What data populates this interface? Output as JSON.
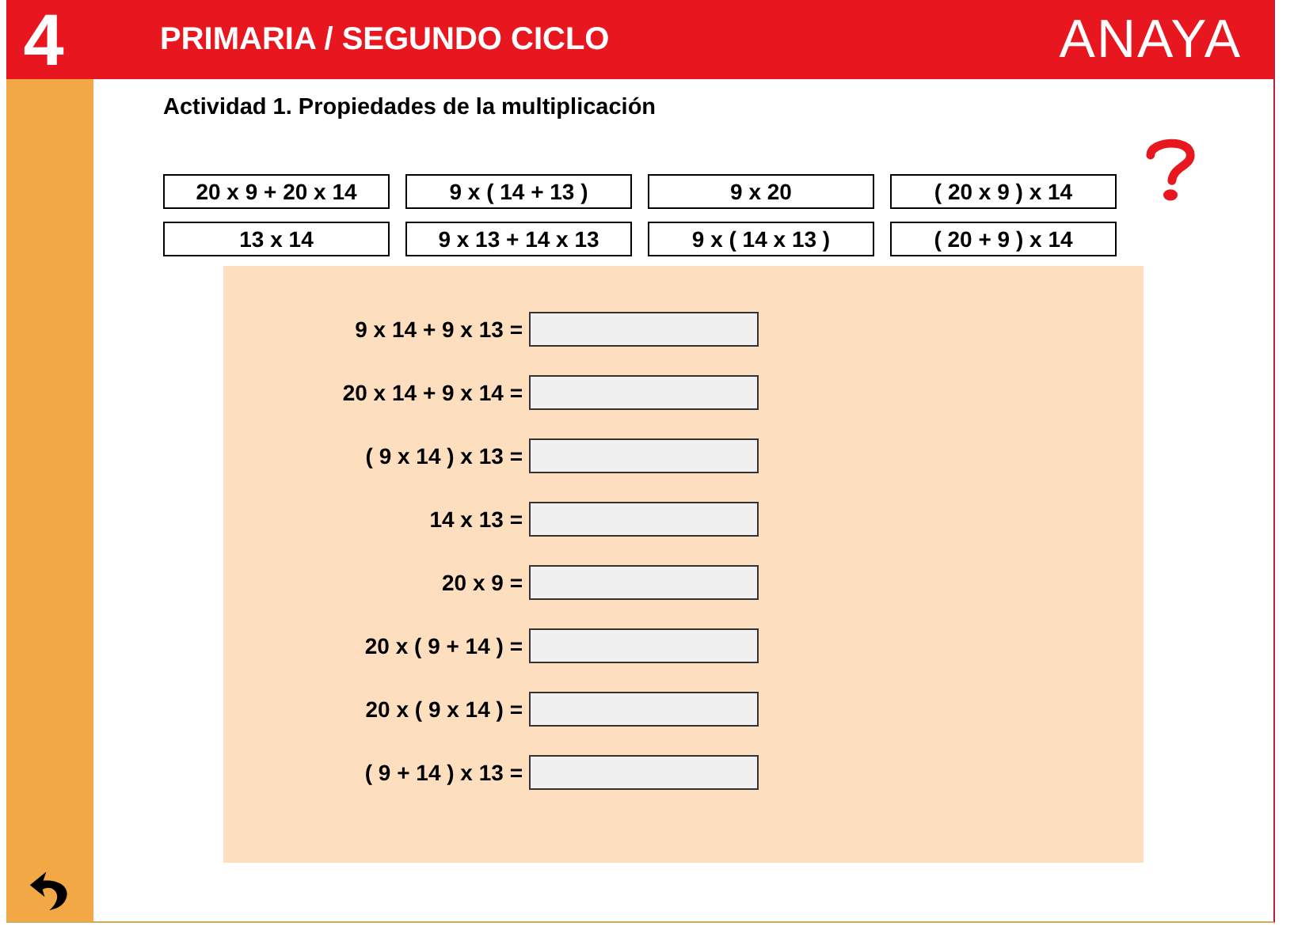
{
  "header": {
    "number": "4",
    "title": "PRIMARIA / SEGUNDO CICLO",
    "logo": "ANAYA"
  },
  "activity": {
    "title": "Actividad 1. Propiedades de la multiplicación"
  },
  "options": [
    "20 x 9 + 20 x 14",
    "9 x ( 14 + 13 )",
    "9 x 20",
    "( 20 x 9 ) x 14",
    "13 x 14",
    "9 x 13 + 14 x 13",
    "9 x ( 14 x 13 )",
    "( 20 + 9 ) x 14"
  ],
  "exercises": [
    {
      "expression": "9 x 14 + 9 x 13 ="
    },
    {
      "expression": "20 x 14 + 9 x 14 ="
    },
    {
      "expression": "( 9 x 14 ) x 13 ="
    },
    {
      "expression": "14 x 13 ="
    },
    {
      "expression": "20 x 9 ="
    },
    {
      "expression": "20 x ( 9 + 14 ) ="
    },
    {
      "expression": "20 x ( 9 x 14 ) ="
    },
    {
      "expression": "( 9 + 14 ) x 13 ="
    }
  ]
}
